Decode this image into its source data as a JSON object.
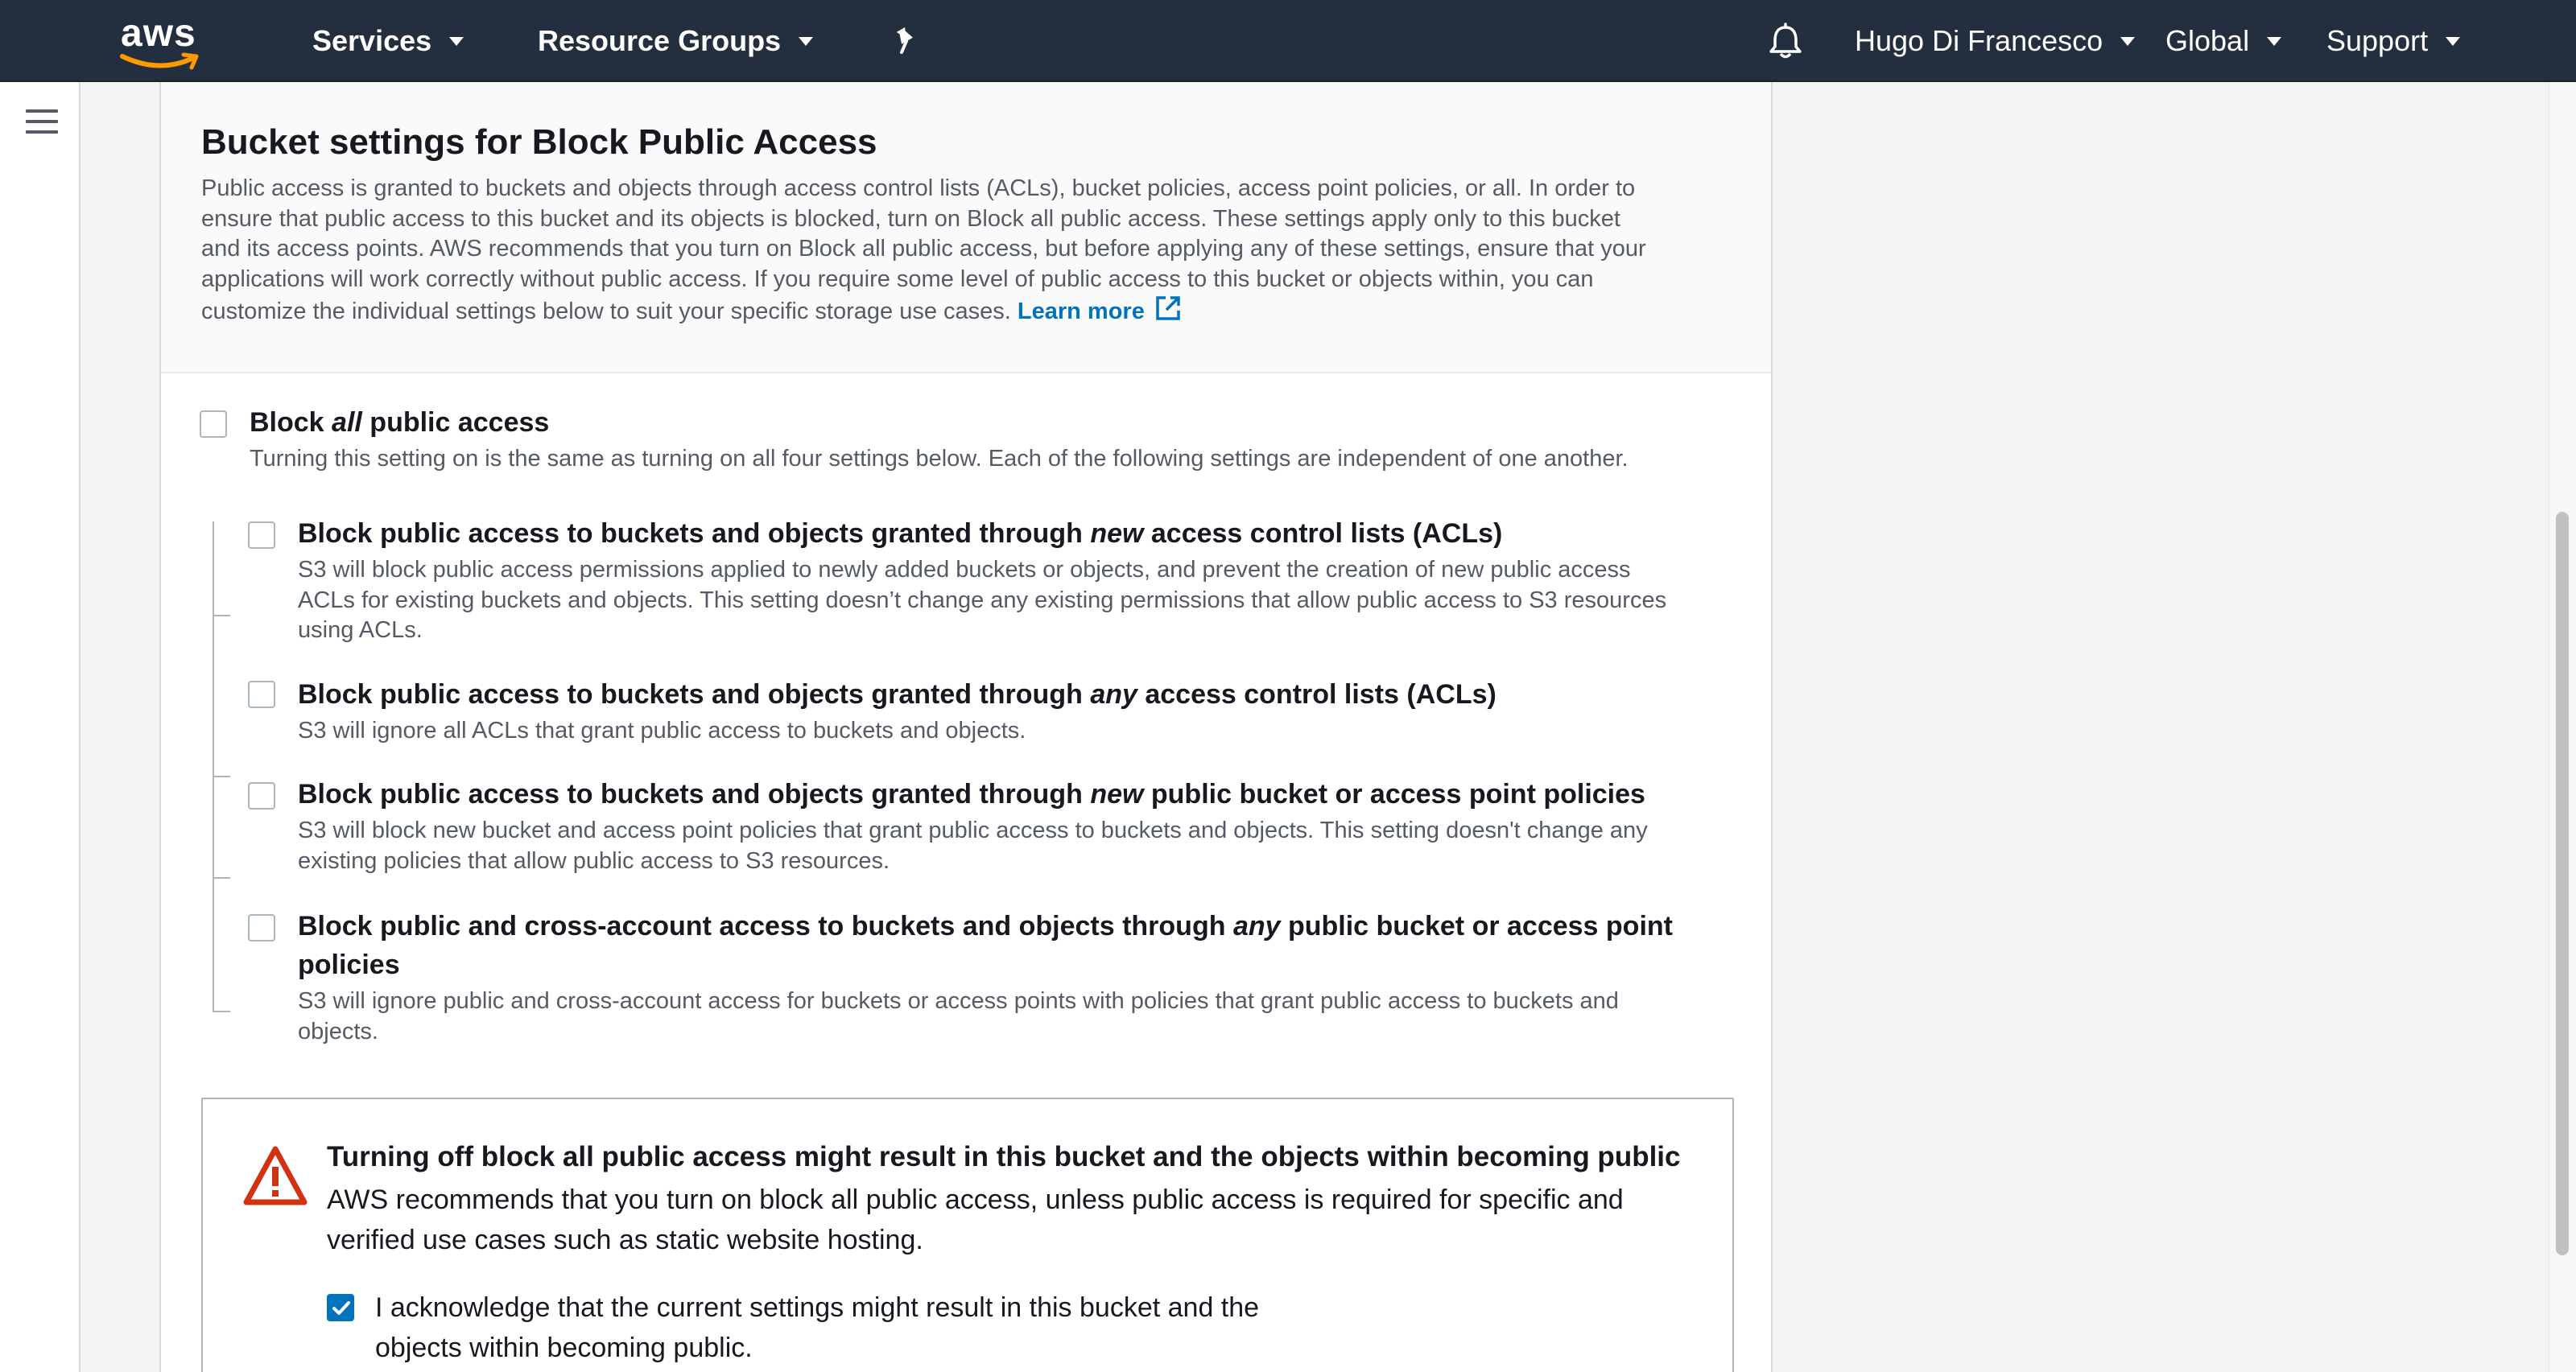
{
  "topnav": {
    "logo_text": "aws",
    "services_label": "Services",
    "resource_groups_label": "Resource Groups",
    "user_label": "Hugo Di Francesco",
    "region_label": "Global",
    "support_label": "Support",
    "icons": [
      "pin-icon",
      "bell-icon"
    ],
    "colors": {
      "background": "#232f3e",
      "logo_smile": "#ff9900"
    }
  },
  "section": {
    "title": "Bucket settings for Block Public Access",
    "description_line1": "Public access is granted to buckets and objects through access control lists (ACLs), bucket policies, access point policies, or all. In order to",
    "description_line2": "ensure that public access to this bucket and its objects is blocked, turn on Block all public access. These settings apply only to this bucket",
    "description_line3": "and its access points. AWS recommends that you turn on Block all public access, but before applying any of these settings, ensure that your",
    "description_line4": "applications will work correctly without public access. If you require some level of public access to this bucket or objects within, you can",
    "description_line5": "customize the individual settings below to suit your specific storage use cases.",
    "learn_more": "Learn more"
  },
  "block_all": {
    "title_before": "Block ",
    "title_italic": "all",
    "title_after": " public access",
    "description": "Turning this setting on is the same as turning on all four settings below. Each of the following settings are independent of one another.",
    "checked": false
  },
  "options": [
    {
      "title_before": "Block public access to buckets and objects granted through ",
      "title_italic": "new",
      "title_after": " access control lists (ACLs)",
      "desc_line1": "S3 will block public access permissions applied to newly added buckets or objects, and prevent the creation of new public access",
      "desc_line2": "ACLs for existing buckets and objects. This setting doesn’t change any existing permissions that allow public access to S3 resources",
      "desc_line3": "using ACLs.",
      "checked": false
    },
    {
      "title_before": "Block public access to buckets and objects granted through ",
      "title_italic": "any",
      "title_after": " access control lists (ACLs)",
      "desc_line1": "S3 will ignore all ACLs that grant public access to buckets and objects.",
      "checked": false
    },
    {
      "title_before": "Block public access to buckets and objects granted through ",
      "title_italic": "new",
      "title_after": " public bucket or access point policies",
      "desc_line1": "S3 will block new bucket and access point policies that grant public access to buckets and objects. This setting doesn't change any",
      "desc_line2": "existing policies that allow public access to S3 resources.",
      "checked": false
    },
    {
      "title_before": "Block public and cross-account access to buckets and objects through ",
      "title_italic": "any",
      "title_after": " public bucket or access point",
      "title_line2": "policies",
      "desc_line1": "S3 will ignore public and cross-account access for buckets or access points with policies that grant public access to buckets and",
      "desc_line2": "objects.",
      "checked": false
    }
  ],
  "warning": {
    "title": "Turning off block all public access might result in this bucket and the objects within becoming public",
    "text_line1": "AWS recommends that you turn on block all public access, unless public access is required for specific and",
    "text_line2": "verified use cases such as static website hosting.",
    "ack_line1": "I acknowledge that the current settings might result in this bucket and the",
    "ack_line2": "objects within becoming public.",
    "ack_checked": true,
    "colors": {
      "warning_icon": "#d13212",
      "checkbox": "#0073bb"
    }
  }
}
